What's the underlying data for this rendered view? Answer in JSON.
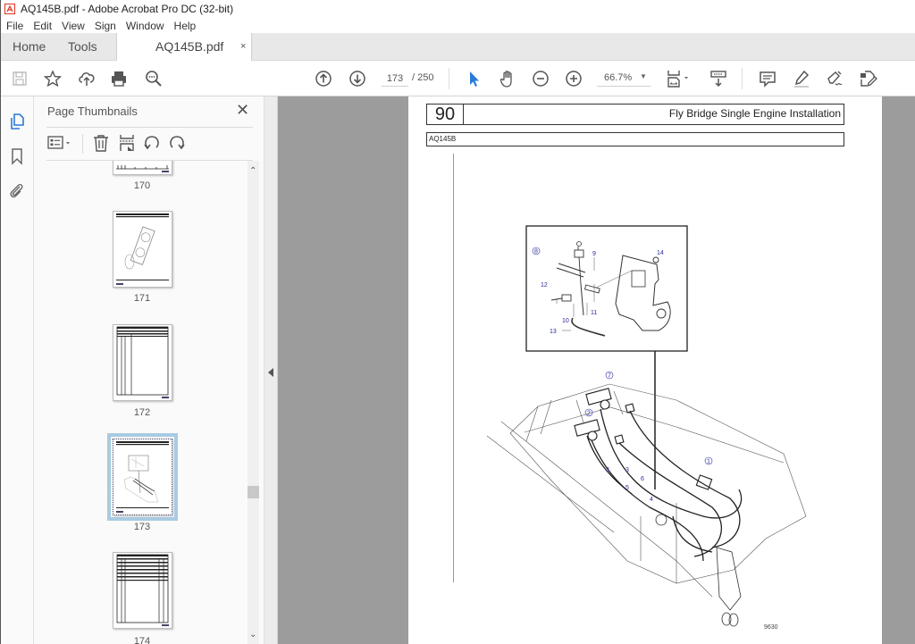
{
  "window": {
    "title": "AQ145B.pdf - Adobe Acrobat Pro DC (32-bit)"
  },
  "menu": [
    "File",
    "Edit",
    "View",
    "Sign",
    "Window",
    "Help"
  ],
  "tabs": {
    "home": "Home",
    "tools": "Tools",
    "document": "AQ145B.pdf",
    "close": "×"
  },
  "toolbar": {
    "current_page": "173",
    "total_pages": "/ 250",
    "zoom": "66.7%",
    "icons": [
      "save-icon",
      "bookmark-star-icon",
      "cloud-upload-icon",
      "print-icon",
      "search-zoom-icon",
      "page-up-icon",
      "page-down-icon",
      "select-cursor-icon",
      "hand-icon",
      "zoom-out-icon",
      "zoom-in-icon",
      "page-fit-icon",
      "scroll-mode-icon",
      "comment-icon",
      "highlight-icon",
      "sign-icon",
      "edit-pdf-icon"
    ]
  },
  "left_rail": {
    "icons": [
      "page-thumbnails-icon",
      "bookmarks-icon",
      "attachments-icon"
    ]
  },
  "thumbnails_panel": {
    "title": "Page Thumbnails",
    "close": "✕",
    "pages": [
      {
        "label": "170",
        "selected": false
      },
      {
        "label": "171",
        "selected": false
      },
      {
        "label": "172",
        "selected": false
      },
      {
        "label": "173",
        "selected": true
      },
      {
        "label": "174",
        "selected": false
      }
    ]
  },
  "document": {
    "section_number": "90",
    "section_title": "Fly Bridge Single Engine Installation",
    "model": "AQ145B",
    "figure_number": "9630",
    "callouts_detail": [
      "8",
      "9",
      "14",
      "12",
      "11",
      "10",
      "13"
    ],
    "callouts_main": [
      "7",
      "2",
      "1",
      "3",
      "3",
      "6",
      "5",
      "4"
    ]
  }
}
